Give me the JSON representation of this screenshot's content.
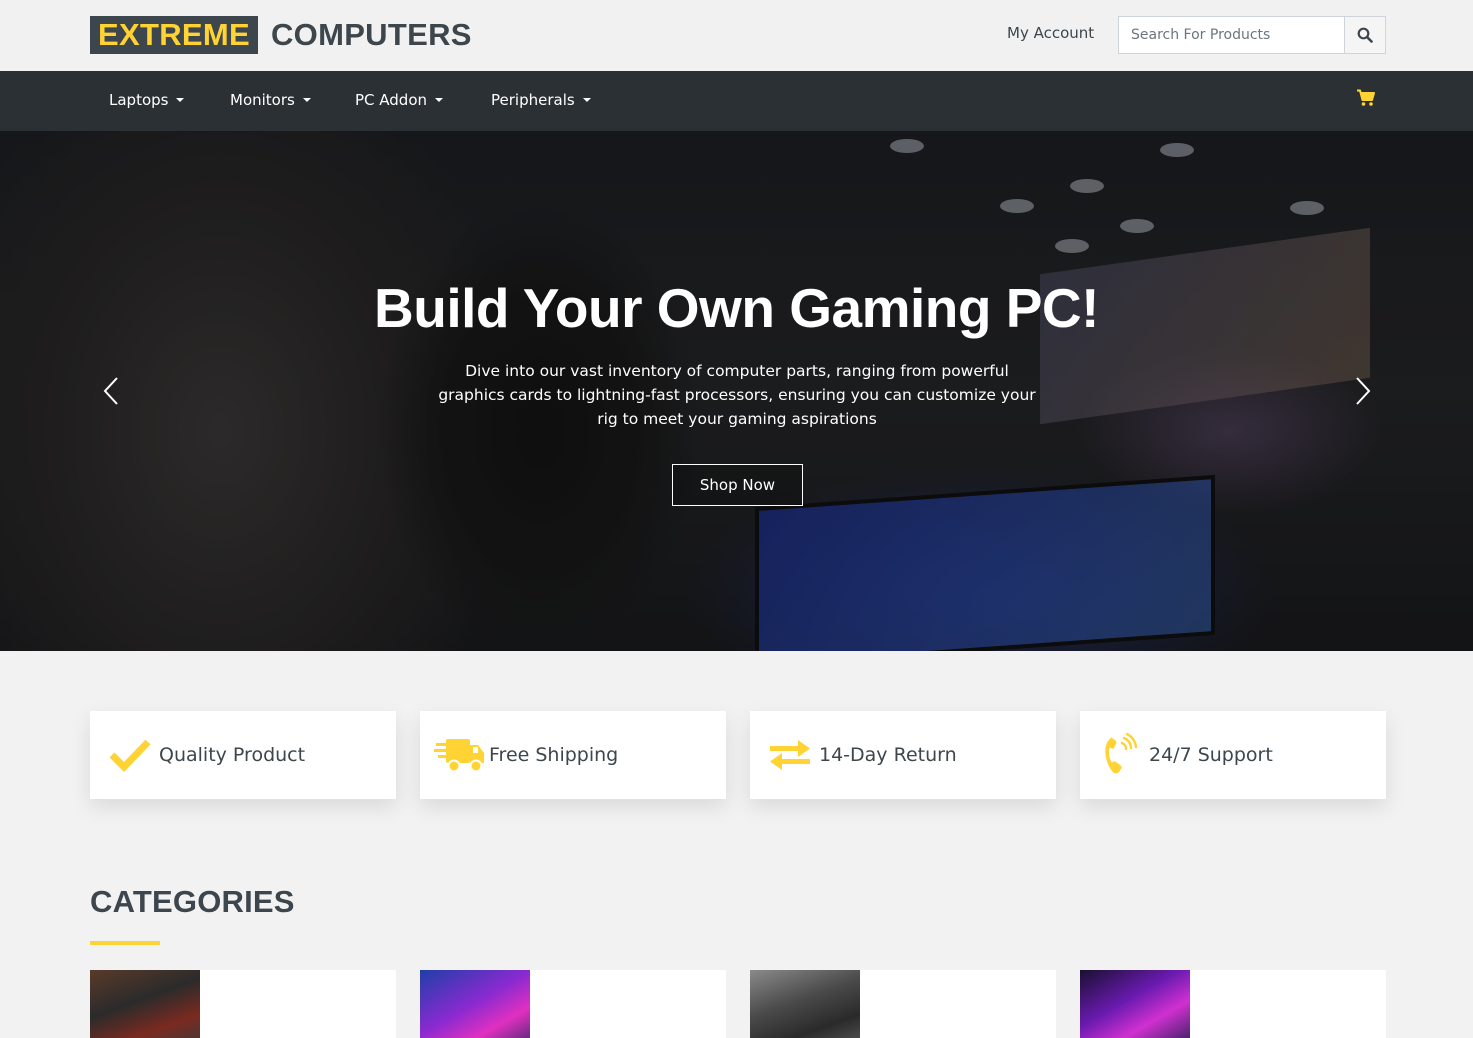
{
  "brand": {
    "highlight": "EXTREME",
    "rest": "COMPUTERS",
    "accent": "#ffd333",
    "dark": "#3d464d"
  },
  "header": {
    "account_label": "My Account",
    "search_placeholder": "Search For Products",
    "search_icon": "search-icon"
  },
  "nav": {
    "items": [
      {
        "label": "Laptops"
      },
      {
        "label": "Monitors"
      },
      {
        "label": "PC Addon"
      },
      {
        "label": "Peripherals"
      }
    ],
    "cart_icon": "cart-icon"
  },
  "hero": {
    "title": "Build Your Own Gaming PC!",
    "text": "Dive into our vast inventory of computer parts, ranging from powerful graphics cards to lightning-fast processors, ensuring you can customize your rig to meet your gaming aspirations",
    "button": "Shop Now"
  },
  "features": [
    {
      "label": "Quality Product",
      "icon": "check-icon"
    },
    {
      "label": "Free Shipping",
      "icon": "truck-icon"
    },
    {
      "label": "14-Day Return",
      "icon": "exchange-icon"
    },
    {
      "label": "24/7 Support",
      "icon": "phone-volume-icon"
    }
  ],
  "categories": {
    "title": "CATEGORIES"
  }
}
